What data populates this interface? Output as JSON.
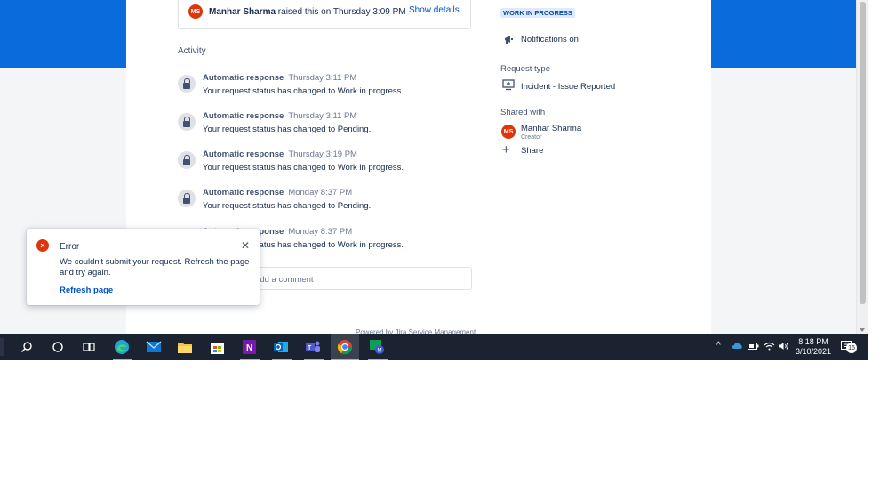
{
  "request": {
    "raised_by": "Manhar Sharma",
    "raised_suffix": " raised this on Thursday 3:09 PM",
    "initials": "MS",
    "show_details": "Show details"
  },
  "activity": {
    "title": "Activity",
    "items": [
      {
        "author": "Automatic response",
        "time": "Thursday 3:11 PM",
        "text": "Your request status has changed to Work in progress."
      },
      {
        "author": "Automatic response",
        "time": "Thursday 3:11 PM",
        "text": "Your request status has changed to Pending."
      },
      {
        "author": "Automatic response",
        "time": "Thursday 3:19 PM",
        "text": "Your request status has changed to Work in progress."
      },
      {
        "author": "Automatic response",
        "time": "Monday 8:37 PM",
        "text": "Your request status has changed to Pending."
      },
      {
        "author": "Automatic response",
        "time": "Monday 8:37 PM",
        "text": "Your request status has changed to Work in progress."
      }
    ]
  },
  "comment": {
    "placeholder": "Add a comment"
  },
  "footer": {
    "powered": "Powered by Jira Service Management"
  },
  "sidebar": {
    "status": "WORK IN PROGRESS",
    "notifications": "Notifications on",
    "request_type_label": "Request type",
    "request_type": "Incident - Issue Reported",
    "shared_with_label": "Shared with",
    "shared_name": "Manhar Sharma",
    "shared_role": "Creator",
    "share": "Share"
  },
  "toast": {
    "title": "Error",
    "message": "We couldn't submit your request. Refresh the page and try again.",
    "link": "Refresh page"
  },
  "taskbar": {
    "time": "8:18 PM",
    "date": "3/10/2021",
    "notification_count": "16"
  },
  "colors": {
    "brand_blue": "#0a6bdc",
    "link": "#0052cc",
    "error": "#de350b",
    "taskbar": "#1c2330"
  }
}
